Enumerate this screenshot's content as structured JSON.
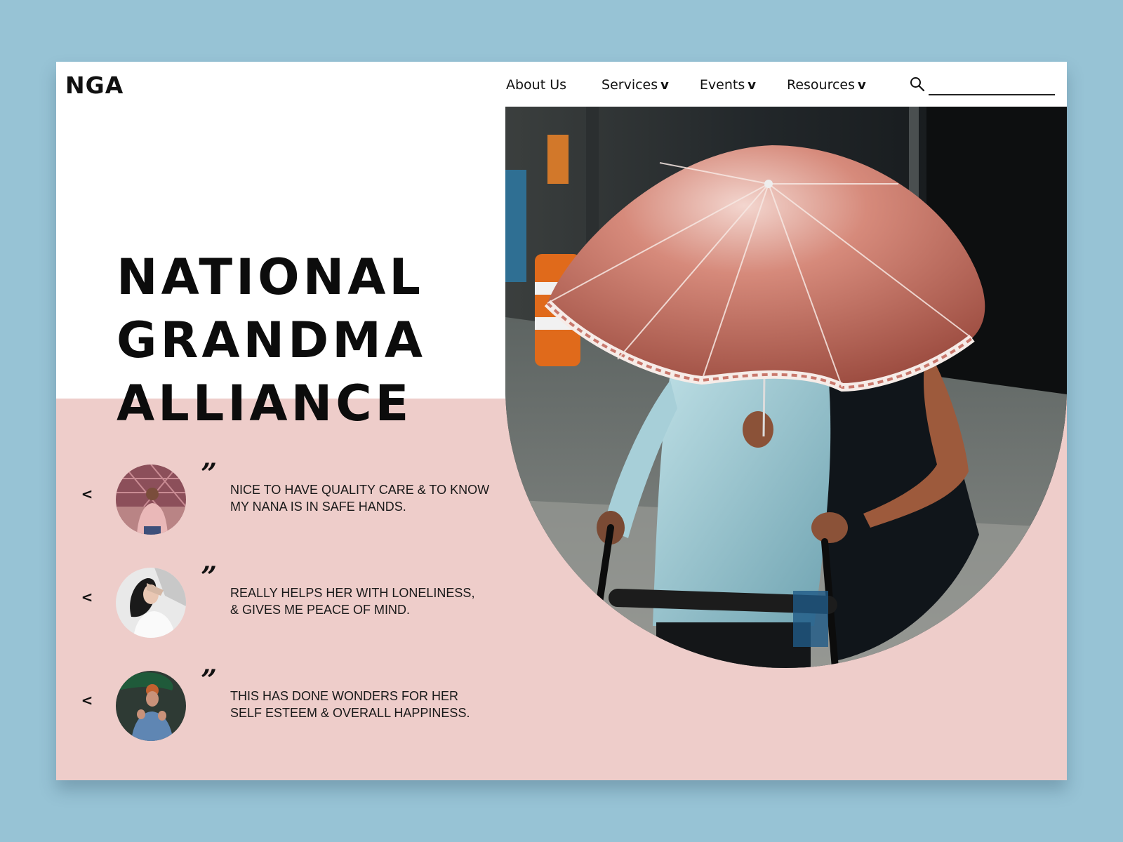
{
  "header": {
    "logo": "NGA",
    "nav": [
      {
        "label": "About Us",
        "has_dropdown": false
      },
      {
        "label": "Services",
        "has_dropdown": true
      },
      {
        "label": "Events",
        "has_dropdown": true
      },
      {
        "label": "Resources",
        "has_dropdown": true
      }
    ],
    "dropdown_glyph": "v",
    "search": {
      "icon": "search-icon",
      "value": "",
      "placeholder": ""
    }
  },
  "hero": {
    "title_lines": [
      "NATIONAL",
      "GRANDMA",
      "ALLIANCE"
    ],
    "photo": "hero-photo-umbrella-walker"
  },
  "testimonials": {
    "prev_glyph": "<",
    "quote_glyph": "”",
    "items": [
      {
        "avatar": "avatar-woman-pink-sweater",
        "lines": [
          "NICE TO HAVE QUALITY CARE & TO KNOW",
          "MY NANA IS IN SAFE HANDS."
        ]
      },
      {
        "avatar": "avatar-woman-white-shirt",
        "lines": [
          "REALLY HELPS HER WITH LONELINESS,",
          "& GIVES ME PEACE OF MIND."
        ]
      },
      {
        "avatar": "avatar-woman-green-umbrella",
        "lines": [
          "THIS HAS DONE WONDERS FOR HER",
          "SELF ESTEEM & OVERALL HAPPINESS."
        ]
      }
    ]
  },
  "colors": {
    "page_background": "#97c3d5",
    "card_background": "#ffffff",
    "pink_band": "#eecdca",
    "text": "#111111"
  }
}
